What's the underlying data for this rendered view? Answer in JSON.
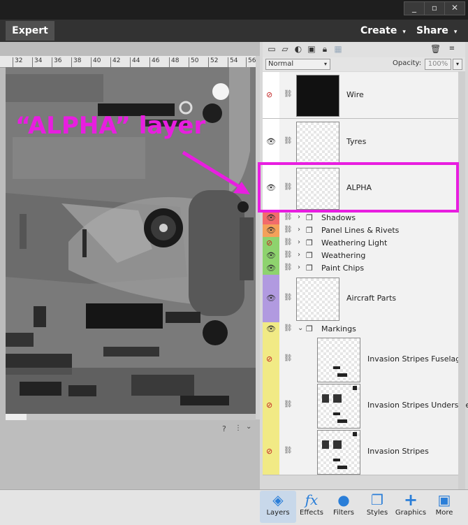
{
  "window": {
    "minimize": "_",
    "restore": "▫",
    "close": "✕"
  },
  "menu": {
    "mode_tab": "Expert",
    "create": "Create",
    "share": "Share",
    "caret": "▾"
  },
  "ruler": {
    "ticks": [
      "32",
      "34",
      "36",
      "38",
      "40",
      "42",
      "44",
      "46",
      "48",
      "50",
      "52",
      "54",
      "56"
    ]
  },
  "annotation": {
    "text": "“ALPHA” layer",
    "color": "#e81ee0"
  },
  "layers_panel": {
    "blend_mode": "Normal",
    "opacity_label": "Opacity:",
    "opacity_value": "100%",
    "layers": [
      {
        "name": "Wire",
        "color": "#ffffff",
        "visible": false,
        "kind": "layer"
      },
      {
        "name": "Tyres",
        "color": "#ffffff",
        "visible": true,
        "kind": "layer"
      },
      {
        "name": "ALPHA",
        "color": "#ffffff",
        "visible": true,
        "kind": "layer"
      },
      {
        "name": "Shadows",
        "color": "#f26b6b",
        "visible": true,
        "kind": "group"
      },
      {
        "name": "Panel Lines & Rivets",
        "color": "#f4a15a",
        "visible": true,
        "kind": "group"
      },
      {
        "name": "Weathering Light",
        "color": "#8ed36e",
        "visible": false,
        "kind": "group"
      },
      {
        "name": "Weathering",
        "color": "#8ed36e",
        "visible": true,
        "kind": "group"
      },
      {
        "name": "Paint Chips",
        "color": "#8ed36e",
        "visible": true,
        "kind": "group"
      },
      {
        "name": "Aircraft Parts",
        "color": "#b19ae0",
        "visible": true,
        "kind": "layer"
      },
      {
        "name": "Markings",
        "color": "#f1ea85",
        "visible": true,
        "kind": "group-open"
      },
      {
        "name": "Invasion Stripes Fuselage ...",
        "color": "#f1ea85",
        "visible": false,
        "kind": "layer"
      },
      {
        "name": "Invasion Stripes Underside...",
        "color": "#f1ea85",
        "visible": false,
        "kind": "layer"
      },
      {
        "name": "Invasion Stripes",
        "color": "#f1ea85",
        "visible": false,
        "kind": "layer"
      }
    ]
  },
  "bottom_bar": [
    {
      "label": "Layers",
      "icon": "layers-icon"
    },
    {
      "label": "Effects",
      "icon": "fx-icon"
    },
    {
      "label": "Filters",
      "icon": "filters-icon"
    },
    {
      "label": "Styles",
      "icon": "styles-icon"
    },
    {
      "label": "Graphics",
      "icon": "graphics-icon"
    },
    {
      "label": "More",
      "icon": "more-icon"
    }
  ],
  "icons": {
    "fx": "fx",
    "plus": "+"
  }
}
